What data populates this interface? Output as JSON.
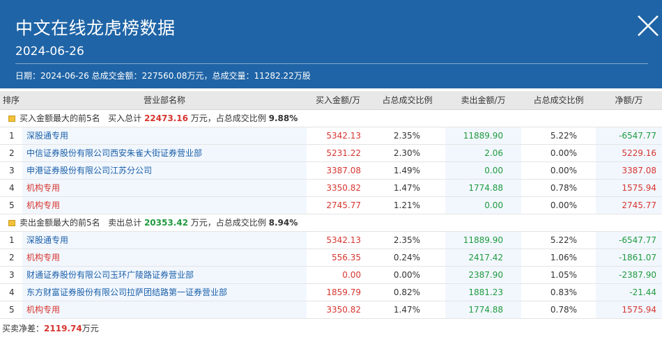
{
  "header": {
    "title": "中文在线龙虎榜数据",
    "date": "2024-06-26",
    "summary": "日期：2024-06-26 总成交金额：227560.08万元，总成交量：11282.22万股"
  },
  "table": {
    "headers": [
      "排序",
      "营业部名称",
      "买入金额/万",
      "占总成交比例",
      "卖出金额/万",
      "占总成交比例",
      "净额/万"
    ],
    "buy_group": {
      "label": "买入金额最大的前5名",
      "total_prefix": "买入总计",
      "total_value": "22473.16",
      "total_suffix": "万元，占总成交比例",
      "ratio": "9.88%",
      "rows": [
        {
          "idx": "1",
          "name": "深股通专用",
          "buy": "5342.13",
          "buy_pct": "2.35%",
          "sell": "11889.90",
          "sell_pct": "5.22%",
          "net": "-6547.77"
        },
        {
          "idx": "2",
          "name": "中信证券股份有限公司西安朱雀大街证券营业部",
          "buy": "5231.22",
          "buy_pct": "2.30%",
          "sell": "2.06",
          "sell_pct": "0.00%",
          "net": "5229.16"
        },
        {
          "idx": "3",
          "name": "申港证券股份有限公司江苏分公司",
          "buy": "3387.08",
          "buy_pct": "1.49%",
          "sell": "0.00",
          "sell_pct": "0.00%",
          "net": "3387.08"
        },
        {
          "idx": "4",
          "name": "机构专用",
          "buy": "3350.82",
          "buy_pct": "1.47%",
          "sell": "1774.88",
          "sell_pct": "0.78%",
          "net": "1575.94"
        },
        {
          "idx": "5",
          "name": "机构专用",
          "buy": "2745.77",
          "buy_pct": "1.21%",
          "sell": "0.00",
          "sell_pct": "0.00%",
          "net": "2745.77"
        }
      ]
    },
    "sell_group": {
      "label": "卖出金额最大的前5名",
      "total_prefix": "卖出总计",
      "total_value": "20353.42",
      "total_suffix": "万元，占总成交比例",
      "ratio": "8.94%",
      "rows": [
        {
          "idx": "1",
          "name": "深股通专用",
          "buy": "5342.13",
          "buy_pct": "2.35%",
          "sell": "11889.90",
          "sell_pct": "5.22%",
          "net": "-6547.77"
        },
        {
          "idx": "2",
          "name": "机构专用",
          "buy": "556.35",
          "buy_pct": "0.24%",
          "sell": "2417.42",
          "sell_pct": "1.06%",
          "net": "-1861.07"
        },
        {
          "idx": "3",
          "name": "财通证券股份有限公司玉环广陵路证券营业部",
          "buy": "0.00",
          "buy_pct": "0.00%",
          "sell": "2387.90",
          "sell_pct": "1.05%",
          "net": "-2387.90"
        },
        {
          "idx": "4",
          "name": "东方财富证券股份有限公司拉萨团结路第一证券营业部",
          "buy": "1859.79",
          "buy_pct": "0.82%",
          "sell": "1881.23",
          "sell_pct": "0.83%",
          "net": "-21.44"
        },
        {
          "idx": "5",
          "name": "机构专用",
          "buy": "3350.82",
          "buy_pct": "1.47%",
          "sell": "1774.88",
          "sell_pct": "0.78%",
          "net": "1575.94"
        }
      ]
    }
  },
  "footer": {
    "label": "买卖净差：",
    "value": "2119.74",
    "unit": "万元"
  },
  "icons": {
    "close": "close-icon",
    "group": "folder-icon"
  },
  "colors": {
    "header_bg": "#1f64a6",
    "red": "#d6352f",
    "green": "#1f9a3f",
    "link_blue": "#1a5fa8",
    "highlight_row": "#f2f7fe"
  }
}
